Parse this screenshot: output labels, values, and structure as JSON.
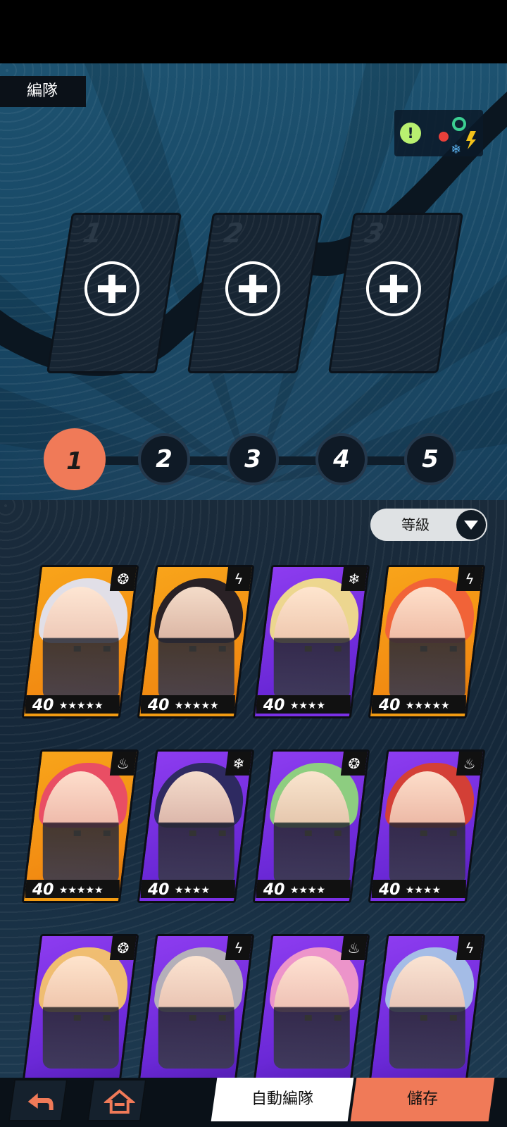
{
  "header": {
    "title": "編隊"
  },
  "element_wheel": {
    "info": "!"
  },
  "slots": [
    {
      "number": "1"
    },
    {
      "number": "2"
    },
    {
      "number": "3"
    }
  ],
  "teams": {
    "steps": [
      "1",
      "2",
      "3",
      "4",
      "5"
    ],
    "active": "1"
  },
  "sort": {
    "label": "等級"
  },
  "characters": [
    {
      "level": "40",
      "stars": "★★★★★",
      "element": "wind-icon",
      "glyph": "❂",
      "rarity": "orange",
      "hair": "#dfe3f2",
      "strip": "#f29b12"
    },
    {
      "level": "40",
      "stars": "★★★★★",
      "element": "electric-icon",
      "glyph": "ϟ",
      "rarity": "orange",
      "hair": "#1e1a26",
      "strip": "#f29b12"
    },
    {
      "level": "40",
      "stars": "★★★★",
      "element": "ice-icon",
      "glyph": "❄",
      "rarity": "purple",
      "hair": "#f2df8a",
      "strip": "#7a30e6"
    },
    {
      "level": "40",
      "stars": "★★★★★",
      "element": "electric-icon",
      "glyph": "ϟ",
      "rarity": "orange",
      "hair": "#f0603a",
      "strip": "#f29b12"
    },
    {
      "level": "40",
      "stars": "★★★★★",
      "element": "fire-icon",
      "glyph": "♨",
      "rarity": "orange",
      "hair": "#e84a68",
      "strip": "#f29b12"
    },
    {
      "level": "40",
      "stars": "★★★★",
      "element": "ice-icon",
      "glyph": "❄",
      "rarity": "purple",
      "hair": "#2a2a5a",
      "strip": "#7a30e6"
    },
    {
      "level": "40",
      "stars": "★★★★",
      "element": "wind-icon",
      "glyph": "❂",
      "rarity": "purple",
      "hair": "#8ed67a",
      "strip": "#7a30e6"
    },
    {
      "level": "40",
      "stars": "★★★★",
      "element": "fire-icon",
      "glyph": "♨",
      "rarity": "purple",
      "hair": "#d8402c",
      "strip": "#7a30e6"
    },
    {
      "level": "",
      "stars": "",
      "element": "wind-icon",
      "glyph": "❂",
      "rarity": "purple",
      "hair": "#f6c56a",
      "strip": "#7a30e6"
    },
    {
      "level": "",
      "stars": "",
      "element": "electric-icon",
      "glyph": "ϟ",
      "rarity": "purple",
      "hair": "#b6b6b6",
      "strip": "#7a30e6"
    },
    {
      "level": "",
      "stars": "",
      "element": "fire-icon",
      "glyph": "♨",
      "rarity": "purple",
      "hair": "#f29ac8",
      "strip": "#7a30e6"
    },
    {
      "level": "",
      "stars": "",
      "element": "electric-icon",
      "glyph": "ϟ",
      "rarity": "purple",
      "hair": "#a6c4e6",
      "strip": "#7a30e6"
    }
  ],
  "footer": {
    "back_icon": "back-arrow-icon",
    "home_icon": "home-icon",
    "auto_label": "自動編隊",
    "save_label": "儲存"
  }
}
